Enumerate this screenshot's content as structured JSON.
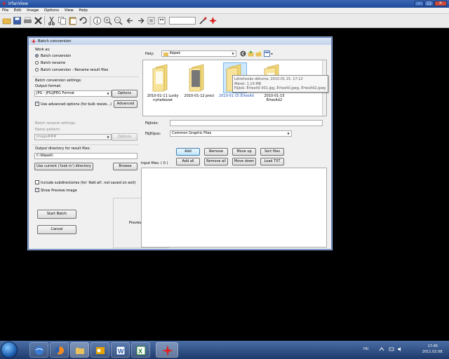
{
  "app": {
    "title": "IrfanView",
    "menu": [
      "File",
      "Edit",
      "Image",
      "Options",
      "View",
      "Help"
    ]
  },
  "dialog": {
    "title": "Batch conversion",
    "work_as": {
      "label": "Work as:",
      "options": [
        "Batch conversion",
        "Batch rename",
        "Batch conversion - Rename result files"
      ],
      "selected": 0
    },
    "conversion": {
      "section_label": "Batch conversion settings:",
      "output_format_label": "Output format:",
      "output_format_value": "JPG - JPG/JPEG Format",
      "options_btn": "Options",
      "advanced_check": "Use advanced options (for bulk resize...)",
      "advanced_btn": "Advanced"
    },
    "rename": {
      "section_label": "Batch rename settings:",
      "name_pattern_label": "Name pattern:",
      "name_pattern_value": "image###",
      "options_btn": "Options"
    },
    "output_dir": {
      "label": "Output directory for result files:",
      "value": "C:\\Képek\\",
      "use_current_btn": "Use current ('look in') directory",
      "browse_btn": "Browse"
    },
    "include_subdirs": "Include subdirectories (for 'Add all', not saved on exit)",
    "show_preview": "Show Preview image",
    "start_btn": "Start Batch",
    "cancel_btn": "Cancel",
    "preview_label": "Preview image",
    "browser": {
      "look_in_label": "Hely:",
      "look_in_value": "Képek",
      "folders": [
        {
          "name": "2010-01-11 Lurdy nyitatkozat"
        },
        {
          "name": "2010-01-12 proci"
        },
        {
          "name": "2010-01-15 Értesítő"
        },
        {
          "name": "2010-01-15 Értesítő2"
        }
      ],
      "tooltip": [
        "Létrehozás dátuma: 2010.01.15. 17:12",
        "Méret: 1,19 MB",
        "Fájlok: Értesítő 001.jpg, Értesítő.jpeg, Értesítő2.jpeg"
      ],
      "filename_label": "Fájlnév:",
      "filename_value": "",
      "filetype_label": "Fájltípus:",
      "filetype_value": "Common Graphic Files"
    },
    "list_buttons": {
      "add": "Add",
      "remove": "Remove",
      "move_up": "Move up",
      "sort_files": "Sort files",
      "add_all": "Add all",
      "remove_all": "Remove all",
      "move_down": "Move down",
      "load_txt": "Load TXT"
    },
    "input_files_label": "Input files: ( 0 )"
  },
  "taskbar": {
    "lang": "HU",
    "time": "17:45",
    "date": "2011.02.08."
  }
}
